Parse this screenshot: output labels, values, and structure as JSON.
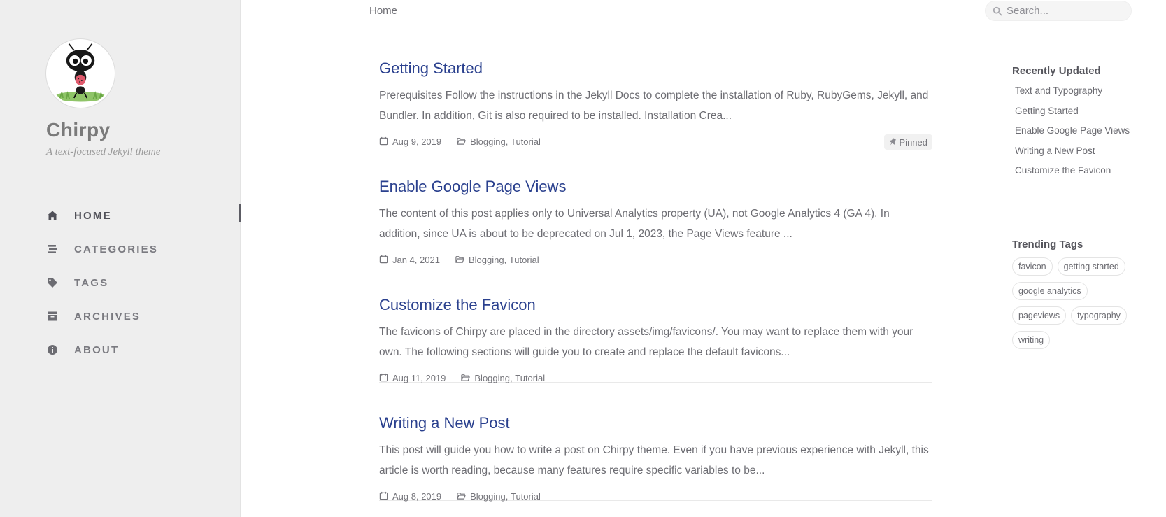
{
  "site": {
    "title": "Chirpy",
    "subtitle": "A text-focused Jekyll theme",
    "avatar_icon": "ant-avatar"
  },
  "nav": {
    "items": [
      {
        "label": "HOME",
        "icon": "home-icon",
        "active": true
      },
      {
        "label": "CATEGORIES",
        "icon": "stream-icon",
        "active": false
      },
      {
        "label": "TAGS",
        "icon": "tag-icon",
        "active": false
      },
      {
        "label": "ARCHIVES",
        "icon": "archive-icon",
        "active": false
      },
      {
        "label": "ABOUT",
        "icon": "info-circle-icon",
        "active": false
      }
    ]
  },
  "topbar": {
    "breadcrumb": "Home",
    "search_placeholder": "Search..."
  },
  "posts": [
    {
      "title": "Getting Started",
      "excerpt": "Prerequisites Follow the instructions in the Jekyll Docs to complete the installation of Ruby, RubyGems, Jekyll, and Bundler. In addition, Git is also required to be installed. Installation Crea...",
      "date": "Aug 9, 2019",
      "category_1": "Blogging",
      "category_sep": ",",
      "category_2": "Tutorial",
      "pinned": "Pinned"
    },
    {
      "title": "Enable Google Page Views",
      "excerpt": "The content of this post applies only to Universal Analytics property (UA), not Google Analytics 4 (GA 4). In addition, since UA is about to be deprecated on Jul 1, 2023, the Page Views feature ...",
      "date": "Jan 4, 2021",
      "category_1": "Blogging",
      "category_sep": ",",
      "category_2": "Tutorial"
    },
    {
      "title": "Customize the Favicon",
      "excerpt": "The favicons of Chirpy are placed in the directory assets/img/favicons/. You may want to replace them with your own. The following sections will guide you to create and replace the default favicons...",
      "date": "Aug 11, 2019",
      "category_1": "Blogging",
      "category_sep": ",",
      "category_2": "Tutorial"
    },
    {
      "title": "Writing a New Post",
      "excerpt": "This post will guide you how to write a post on Chirpy theme. Even if you have previous experience with Jekyll, this article is worth reading, because many features require specific variables to be...",
      "date": "Aug 8, 2019",
      "category_1": "Blogging",
      "category_sep": ",",
      "category_2": "Tutorial"
    }
  ],
  "recently_updated": {
    "heading": "Recently Updated",
    "items": [
      "Text and Typography",
      "Getting Started",
      "Enable Google Page Views",
      "Writing a New Post",
      "Customize the Favicon"
    ]
  },
  "trending_tags": {
    "heading": "Trending Tags",
    "items": [
      "favicon",
      "getting started",
      "google analytics",
      "pageviews",
      "typography",
      "writing"
    ]
  },
  "colors": {
    "sidebar_bg": "#eeeeee",
    "post_title": "#2a408e",
    "body_text": "#6d6d73"
  }
}
